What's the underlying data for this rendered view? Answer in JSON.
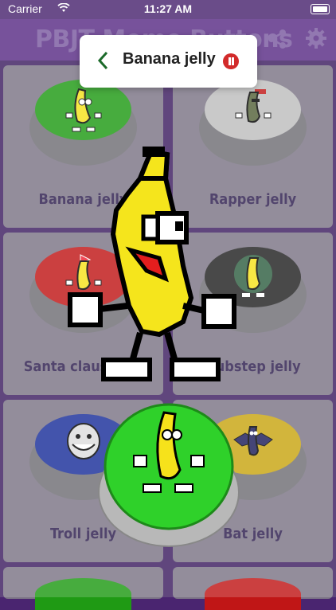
{
  "status_bar": {
    "carrier": "Carrier",
    "time": "11:27 AM"
  },
  "app_bar": {
    "title": "PBJT Meme Buttons",
    "icons": [
      "share-icon",
      "gear-icon"
    ]
  },
  "toast": {
    "title": "Banana jelly",
    "back_icon": "chevron-left-icon",
    "pause_icon": "pause-icon"
  },
  "buttons": [
    {
      "label": "Banana jelly",
      "color": "#1f9a14"
    },
    {
      "label": "Rapper jelly",
      "color": "#bdbdbd"
    },
    {
      "label": "Santa claus jelly",
      "color": "#c01616"
    },
    {
      "label": "Dubstep jelly",
      "color": "#222222"
    },
    {
      "label": "Troll jelly",
      "color": "#1a2f9a"
    },
    {
      "label": "Bat jelly",
      "color": "#c9a512"
    }
  ],
  "now_playing": {
    "color": "#2fd12a"
  }
}
